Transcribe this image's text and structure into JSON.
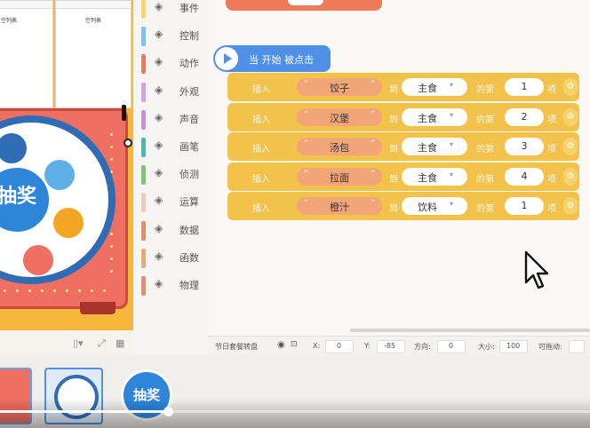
{
  "stage": {
    "list_panels": [
      {
        "empty_label": "空列表"
      },
      {
        "empty_label": "空列表"
      }
    ],
    "hub_label": "抽奖"
  },
  "categories": [
    {
      "label": "事件",
      "icon": "event-icon",
      "color": "#ffd65a"
    },
    {
      "label": "控制",
      "icon": "gamepad-icon",
      "color": "#6ec6ff"
    },
    {
      "label": "动作",
      "icon": "running-icon",
      "color": "#ef7a5a"
    },
    {
      "label": "外观",
      "icon": "shirt-icon",
      "color": "#d69cf0"
    },
    {
      "label": "声音",
      "icon": "speaker-icon",
      "color": "#cf8ae6"
    },
    {
      "label": "画笔",
      "icon": "pencil-icon",
      "color": "#3fbfb0"
    },
    {
      "label": "侦测",
      "icon": "radar-icon",
      "color": "#7dc86a"
    },
    {
      "label": "运算",
      "icon": "calculator-icon",
      "color": "#f3c8b8"
    },
    {
      "label": "数据",
      "icon": "sqrt-icon",
      "color": "#f08a5a"
    },
    {
      "label": "函数",
      "icon": "function-icon",
      "color": "#f0a872"
    },
    {
      "label": "物理",
      "icon": "magnet-icon",
      "color": "#f08a6a"
    }
  ],
  "script": {
    "hat_label": "当 开始 被点击",
    "row_labels": {
      "insert": "插入",
      "to": "到",
      "position": "的第",
      "item": "项"
    },
    "rows": [
      {
        "item": "饺子",
        "list": "主食",
        "index": "1"
      },
      {
        "item": "汉堡",
        "list": "主食",
        "index": "2"
      },
      {
        "item": "汤包",
        "list": "主食",
        "index": "3"
      },
      {
        "item": "拉面",
        "list": "主食",
        "index": "4"
      },
      {
        "item": "橙汁",
        "list": "饮料",
        "index": "1"
      }
    ]
  },
  "status": {
    "sprite_name": "节日套餐转盘",
    "x_label": "X:",
    "x": "0",
    "y_label": "Y:",
    "y": "-85",
    "dir_label": "方向:",
    "dir": "0",
    "size_label": "大小:",
    "size": "100",
    "drag_label": "可拖动:"
  },
  "sprites": {
    "second_label": "抽奖"
  },
  "video": {
    "progress": 0.285
  },
  "colors": {
    "block_yellow": "#f2c24a",
    "hat_blue": "#4f8fe6",
    "stage_orange": "#f6b73c"
  }
}
